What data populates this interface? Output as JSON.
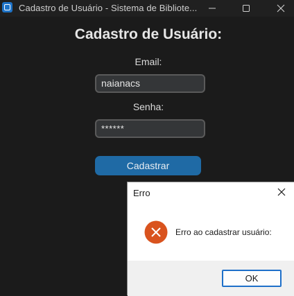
{
  "window": {
    "title": "Cadastro de Usuário - Sistema de Bibliote...",
    "icon": "app-icon"
  },
  "form": {
    "heading": "Cadastro de Usuário:",
    "email_label": "Email:",
    "email_value": "naianacs",
    "password_label": "Senha:",
    "password_value": "******",
    "submit_label": "Cadastrar"
  },
  "dialog": {
    "title": "Erro",
    "message": "Erro ao cadastrar usuário:",
    "ok_label": "OK",
    "icon": "error-icon"
  },
  "colors": {
    "background": "#1b1b1b",
    "accent_button": "#1f6aa5",
    "error_icon": "#d9531e"
  }
}
